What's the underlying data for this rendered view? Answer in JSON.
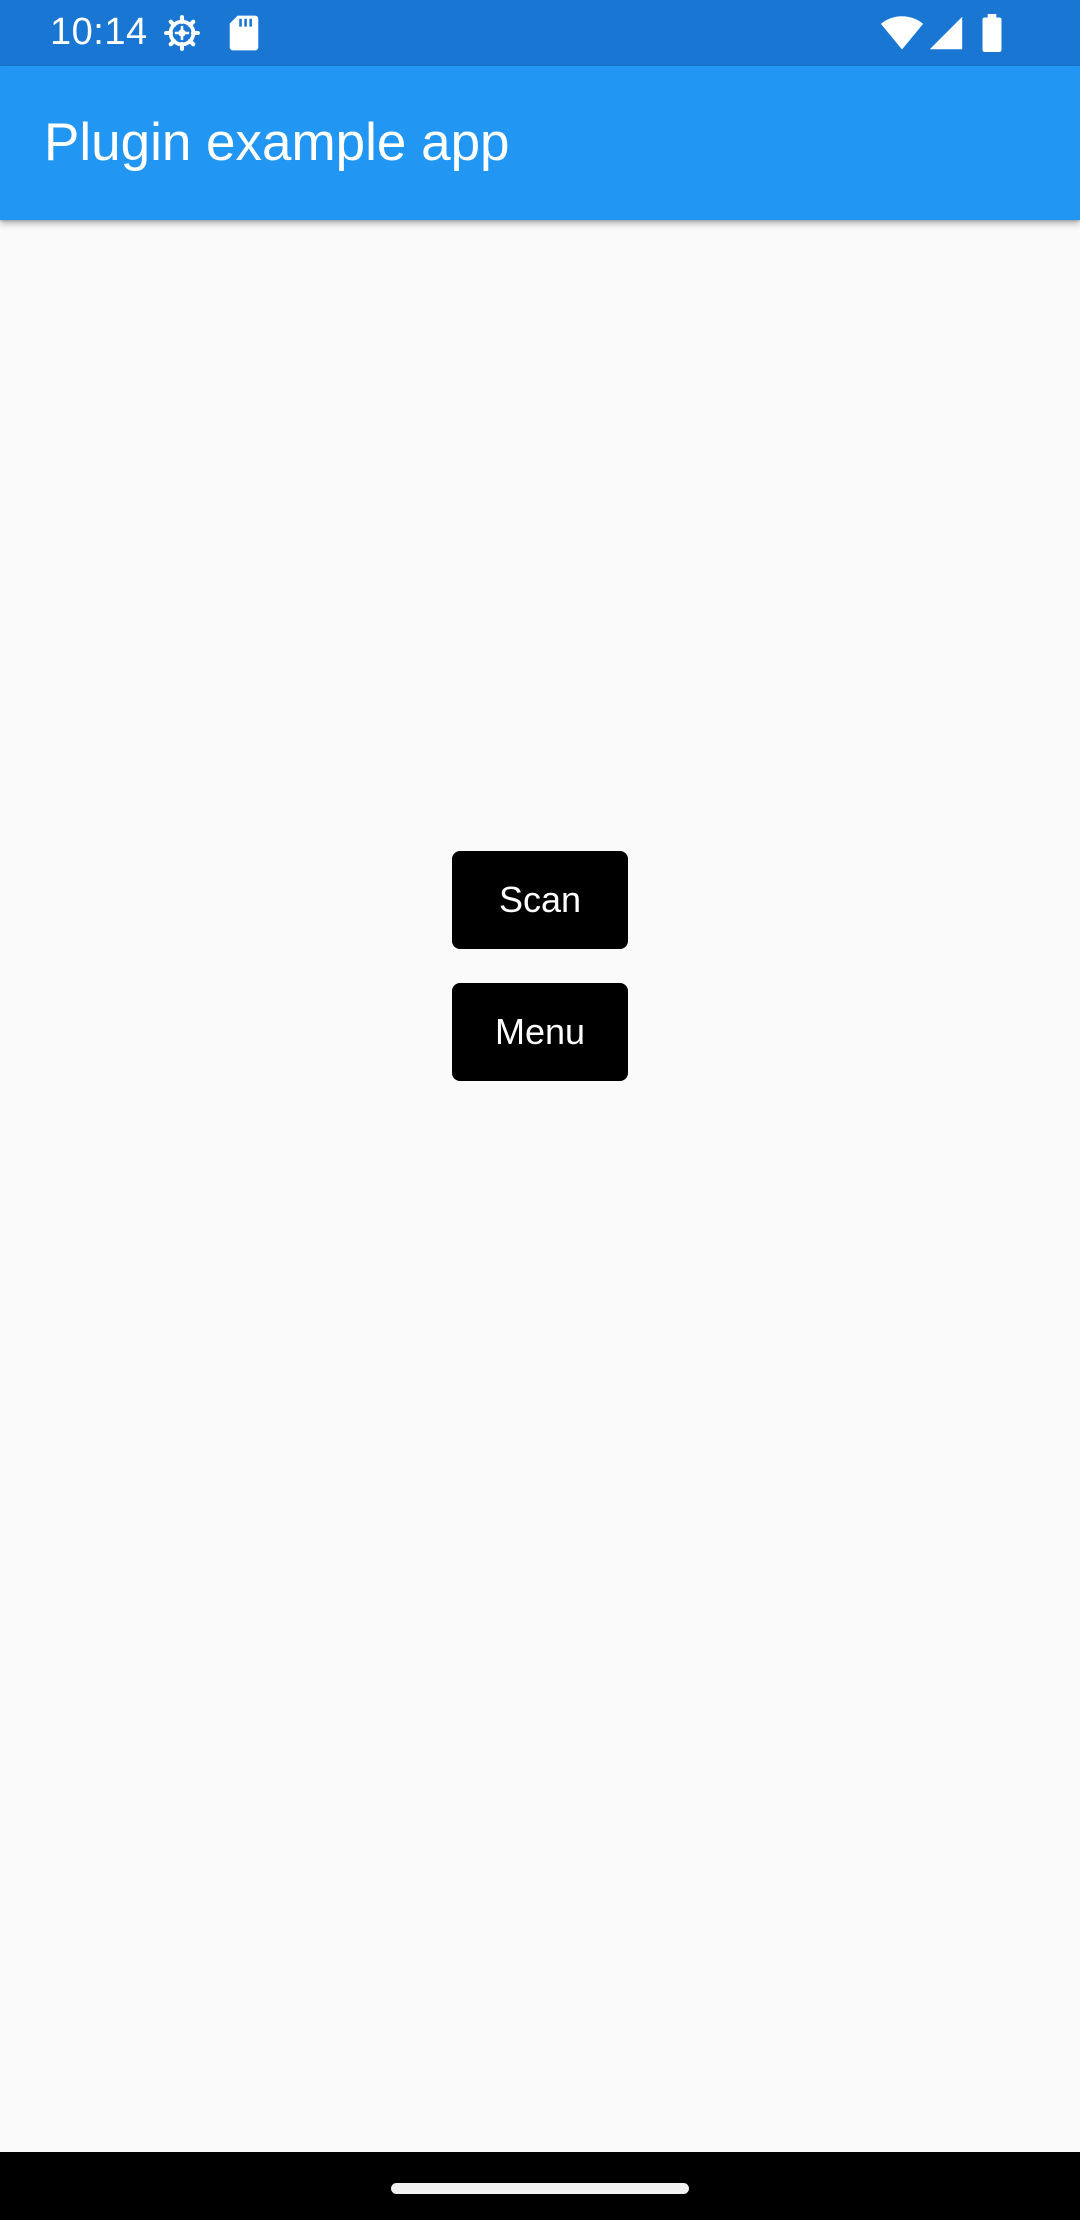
{
  "status_bar": {
    "time": "10:14",
    "icons": [
      "settings-gear-icon",
      "sd-card-icon",
      "wifi-icon",
      "signal-icon",
      "battery-icon"
    ]
  },
  "app_bar": {
    "title": "Plugin example app",
    "color": "#2196f3"
  },
  "main": {
    "buttons": [
      {
        "label": "Scan"
      },
      {
        "label": "Menu"
      }
    ]
  },
  "colors": {
    "status_bar": "#1976d2",
    "background": "#fafafa",
    "button": "#000000",
    "button_text": "#ffffff"
  }
}
